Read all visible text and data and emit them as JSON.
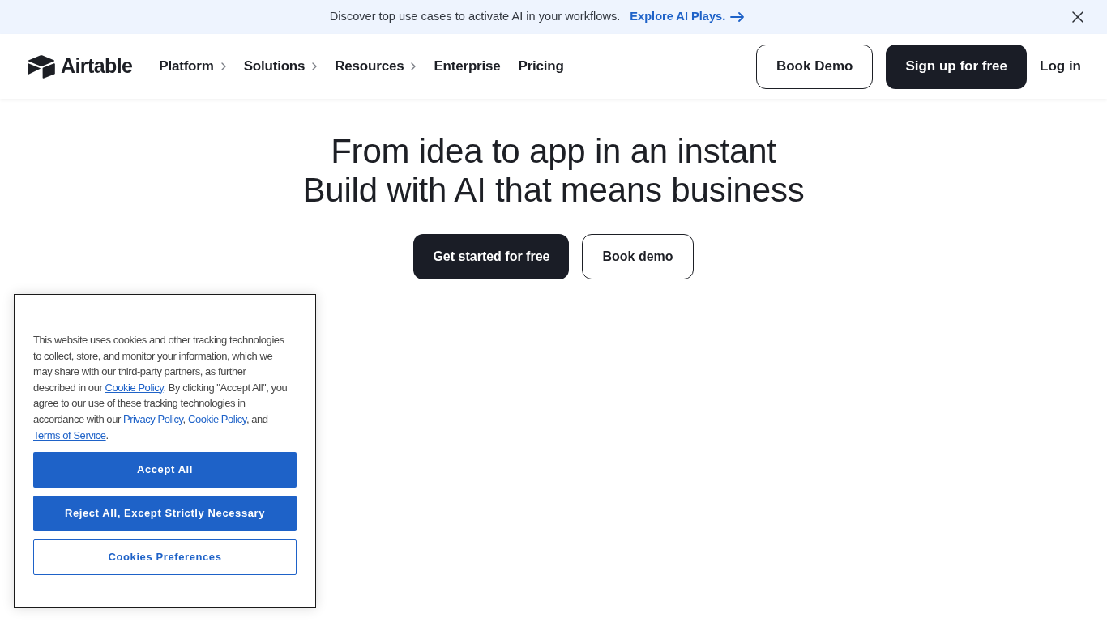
{
  "banner": {
    "message": "Discover top use cases to activate AI in your workflows.",
    "link": "Explore AI Plays."
  },
  "nav": {
    "logo": "Airtable",
    "items": [
      {
        "label": "Platform",
        "submenu": true
      },
      {
        "label": "Solutions",
        "submenu": true
      },
      {
        "label": "Resources",
        "submenu": true
      },
      {
        "label": "Enterprise",
        "submenu": false
      },
      {
        "label": "Pricing",
        "submenu": false
      }
    ],
    "actions": [
      {
        "label": "Book Demo",
        "kind": "outline"
      },
      {
        "label": "Sign up for free",
        "kind": "primary"
      },
      {
        "label": "Log in",
        "kind": "link"
      }
    ]
  },
  "hero": {
    "headline": [
      "From idea to app in an instant",
      "Build with AI that means business"
    ],
    "buttons": [
      {
        "label": "Get started for free",
        "kind": "primary"
      },
      {
        "label": "Book demo",
        "kind": "outline"
      }
    ]
  },
  "cookie_notice": {
    "message": [
      {
        "kind": "text",
        "text": "This website uses cookies and other tracking technologies to collect, store, and monitor your information, which we may share with our third-party partners, as further described in our "
      },
      {
        "kind": "link",
        "text": "Cookie Policy"
      },
      {
        "kind": "text",
        "text": ". By clicking \"Accept All\", you agree to our use of these tracking technologies in accordance with our "
      },
      {
        "kind": "link",
        "text": "Privacy Policy"
      },
      {
        "kind": "text",
        "text": ", "
      },
      {
        "kind": "link",
        "text": "Cookie Policy"
      },
      {
        "kind": "text",
        "text": ", and "
      },
      {
        "kind": "link",
        "text": "Terms of Service"
      },
      {
        "kind": "text",
        "text": "."
      }
    ],
    "buttons": [
      {
        "label": "Accept All",
        "kind": "primary"
      },
      {
        "label": "Reject All, Except Strictly Necessary",
        "kind": "primary"
      },
      {
        "label": "Cookies Preferences",
        "kind": "outline"
      }
    ]
  }
}
